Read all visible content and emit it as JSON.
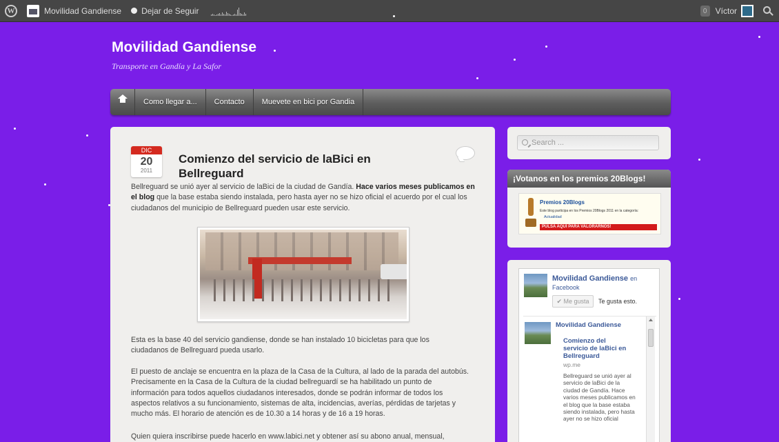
{
  "adminbar": {
    "site_name": "Movilidad Gandiense",
    "follow": "Dejar de Seguir",
    "notifications": "0",
    "user": "Víctor"
  },
  "site": {
    "title": "Movilidad Gandiense",
    "description": "Transporte en Gandía y La Safor"
  },
  "nav": {
    "items": [
      {
        "label": "Como llegar a..."
      },
      {
        "label": "Contacto"
      },
      {
        "label": "Muevete en bici por Gandia"
      }
    ]
  },
  "post": {
    "month": "DIC",
    "day": "20",
    "year": "2011",
    "title": "Comienzo del servicio de laBici en Bellreguard",
    "p1_a": "Bellreguard se unió ayer al servicio de laBici de la ciudad de Gandía.",
    "p1_link": "Hace varios meses publicamos en el blog",
    "p1_b": "que la base estaba siendo instalada, pero hasta ayer no se hizo oficial el acuerdo por el cual los ciudadanos del municipio de Bellreguard pueden usar este servicio.",
    "p2": "Esta es la base 40 del servicio gandiense, donde se han instalado 10 bicicletas para que los ciudadanos de Bellreguard pueda usarlo.",
    "p3": "El puesto de anclaje se encuentra en la plaza de la Casa de la Cultura, al lado de la parada del autobús. Precisamente en la Casa de la Cultura de la ciudad bellreguardí se ha habilitado un punto de información para todos aquellos ciudadanos interesados, donde se podrán informar de todos los aspectos relativos a su funcionamiento, sistemas de alta, incidencias, averías, pérdidas de tarjetas y mucho más. El horario de atención es de 10.30 a 14 horas y de 16 a 19 horas.",
    "p4": "Quien quiera inscribirse puede hacerlo en www.labici.net y obtener así su abono anual, mensual,"
  },
  "sidebar": {
    "search_placeholder": "Search ...",
    "premios": {
      "title": "¡Votanos en los premios 20Blogs!",
      "banner_title": "Premios 20Blogs",
      "banner_desc": "Este blog participa en los Premios 20Blogs 2011 en la categoría:",
      "banner_category": "Actualidad",
      "banner_button": "PULSA AQUÍ PARA VALORARNOS!"
    },
    "facebook": {
      "page_name": "Movilidad Gandiense",
      "on": "en",
      "network": "Facebook",
      "like_button": "✔ Me gusta",
      "like_text": "Te gusta esto.",
      "feed_name": "Movilidad Gandiense",
      "feed_title": "Comienzo del servicio de laBici en Bellreguard",
      "feed_domain": "wp.me",
      "feed_text": "Bellreguard se unió ayer al servicio de laBici de la ciudad de Gandía. Hace varios meses publicamos en el blog que la base estaba siendo instalada, pero hasta ayer no se hizo oficial"
    }
  },
  "colors": {
    "background": "#7a1ee8",
    "adminbar": "#464646",
    "date_badge": "#d42a1f"
  }
}
